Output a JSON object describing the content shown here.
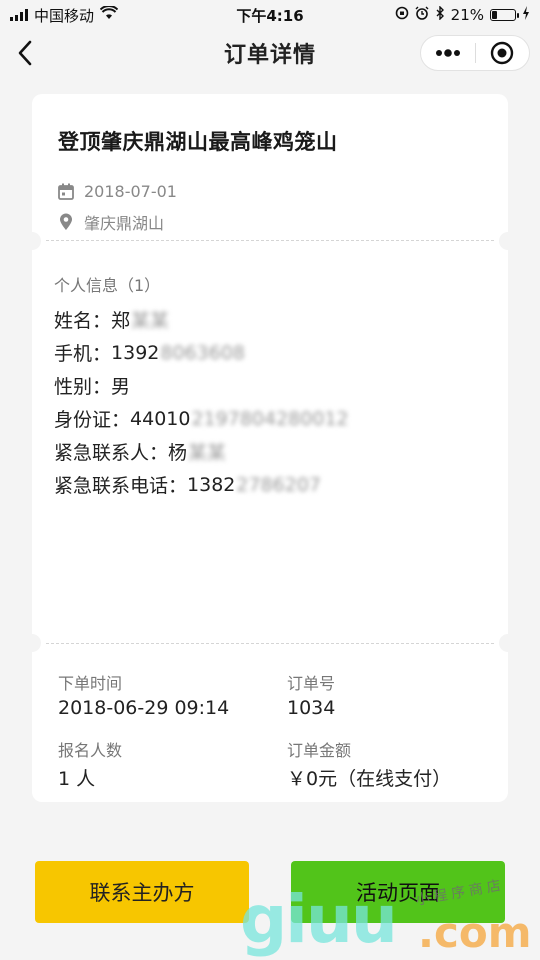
{
  "status_bar": {
    "carrier": "中国移动",
    "time": "下午4:16",
    "battery": "21%",
    "battery_level": 0.21
  },
  "nav": {
    "title": "订单详情"
  },
  "event": {
    "title": "登顶肇庆鼎湖山最高峰鸡笼山",
    "date": "2018-07-01",
    "location": "肇庆鼎湖山"
  },
  "personal": {
    "section_label": "个人信息（1）",
    "rows": [
      {
        "label": "姓名：",
        "value": "郑",
        "masked": "某某"
      },
      {
        "label": "手机：",
        "value": "1392",
        "masked": "8063608"
      },
      {
        "label": "性别：",
        "value": "男",
        "masked": ""
      },
      {
        "label": "身份证：",
        "value": "44010",
        "masked": "2197804280012"
      },
      {
        "label": "紧急联系人：",
        "value": "杨",
        "masked": "某某"
      },
      {
        "label": "紧急联系电话：",
        "value": "1382",
        "masked": "2786207"
      }
    ]
  },
  "order": {
    "time_label": "下单时间",
    "time_value": "2018-06-29 09:14",
    "number_label": "订单号",
    "number_value": "1034",
    "count_label": "报名人数",
    "count_value": "1 人",
    "amount_label": "订单金额",
    "amount_value": "￥0元（在线支付）"
  },
  "buttons": {
    "contact": "联系主办方",
    "activity": "活动页面"
  },
  "watermark": {
    "big": "giuu",
    "com": ".com",
    "small": "小程序商店"
  },
  "colors": {
    "contact_button": "#f7c600",
    "activity_button": "#52c41a",
    "background": "#f4f4f4"
  }
}
